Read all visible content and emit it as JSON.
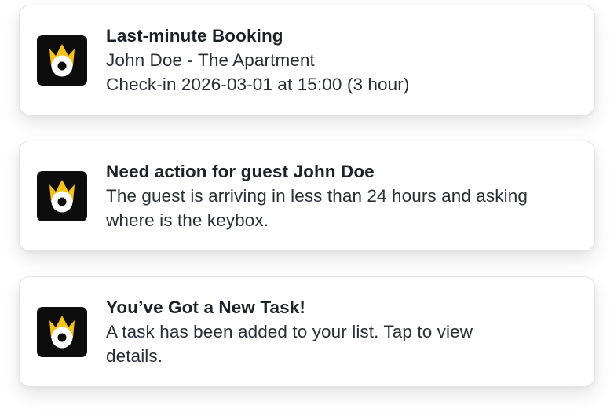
{
  "notifications": [
    {
      "icon": "crown-eye-logo-icon",
      "title": "Last-minute Booking",
      "lines": [
        "John Doe - The Apartment",
        "Check-in 2026-03-01 at 15:00 (3 hour)"
      ]
    },
    {
      "icon": "crown-eye-logo-icon",
      "title": "Need action for guest John Doe",
      "lines": [
        "The guest is arriving in less than 24 hours and asking",
        "where is the keybox."
      ]
    },
    {
      "icon": "crown-eye-logo-icon",
      "title": "You’ve Got a New Task!",
      "lines": [
        "A task has been added to your list. Tap to view",
        "details."
      ]
    }
  ],
  "colors": {
    "icon_background": "#0c0c0c",
    "crown": "#f6c21a",
    "eye_white": "#ffffff",
    "pupil": "#0c0c0c",
    "text": "#23272f",
    "card_border": "#e3e5e8"
  }
}
